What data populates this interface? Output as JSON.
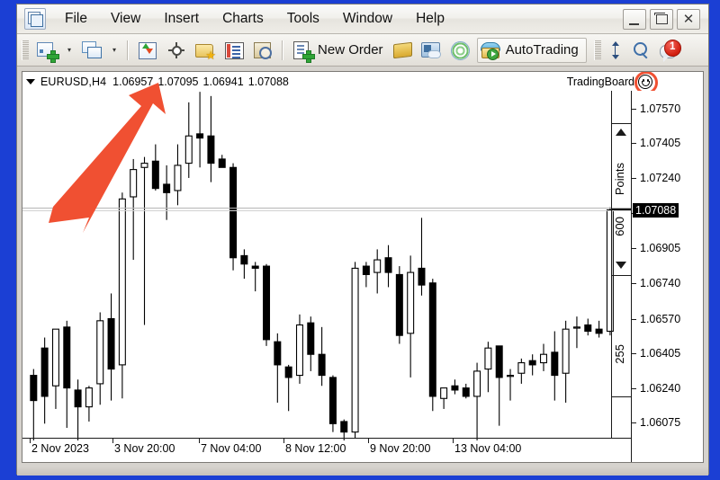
{
  "window": {
    "app_icon": "chart-app-icon",
    "menu": [
      "File",
      "View",
      "Insert",
      "Charts",
      "Tools",
      "Window",
      "Help"
    ],
    "controls": {
      "minimize": "minimize-button",
      "maximize": "maximize-button",
      "close": "close-button"
    }
  },
  "toolbar": {
    "new_chart": "new-chart-button",
    "new_chart_dropdown": "▾",
    "tile_windows": "tile-windows-button",
    "tile_dropdown": "▾",
    "market_watch": "market-watch-button",
    "crosshair": "crosshair-button",
    "favorites": "favorites-button",
    "data_window": "data-window-button",
    "navigator_search": "navigator-search-button",
    "new_order_label": "New Order",
    "notes": "notes-button",
    "news": "news-button",
    "signals": "signals-button",
    "autotrading_label": "AutoTrading",
    "resize_vertical": "resize-vertical-button",
    "zoom": "zoom-button",
    "alerts_badge": "1"
  },
  "chart": {
    "symbol": "EURUSD,H4",
    "ohlc": [
      "1.06957",
      "1.07095",
      "1.06941",
      "1.07088"
    ],
    "indicator_label": "TradingBoard",
    "smiley_icon": "smiley-face-icon",
    "current_price": "1.07088",
    "price_labels": [
      "1.07570",
      "1.07405",
      "1.07240",
      "1.06905",
      "1.06740",
      "1.06570",
      "1.06405",
      "1.06240",
      "1.06075"
    ],
    "time_labels": [
      "2 Nov 2023",
      "3 Nov 20:00",
      "7 Nov 04:00",
      "8 Nov 12:00",
      "9 Nov 20:00",
      "13 Nov 04:00"
    ],
    "gauge": {
      "up_arrow": "▲",
      "points_label": "Points",
      "spread_value": "600",
      "down_arrow": "▼",
      "lower_value": "255"
    },
    "annotation": {
      "arrow_color": "#F05032",
      "highlight_color": "#F05032",
      "target": "smiley-face-icon"
    }
  },
  "chart_data": {
    "type": "candlestick",
    "title": "EURUSD,H4",
    "xlabel": "",
    "ylabel": "",
    "ylim": [
      1.0599,
      1.07655
    ],
    "grid": false,
    "price_axis_ticks": [
      1.0757,
      1.07405,
      1.0724,
      1.07075,
      1.06905,
      1.0674,
      1.0657,
      1.06405,
      1.0624,
      1.06075
    ],
    "x_tick_labels": [
      "2 Nov 2023",
      "3 Nov 20:00",
      "7 Nov 04:00",
      "8 Nov 12:00",
      "9 Nov 20:00",
      "13 Nov 04:00"
    ],
    "current_price_line": 1.07088,
    "candles": [
      {
        "o": 1.063,
        "h": 1.0633,
        "l": 1.059,
        "c": 1.0618
      },
      {
        "o": 1.0643,
        "h": 1.0648,
        "l": 1.0607,
        "c": 1.062
      },
      {
        "o": 1.0625,
        "h": 1.0634,
        "l": 1.0614,
        "c": 1.0652
      },
      {
        "o": 1.0653,
        "h": 1.0656,
        "l": 1.0605,
        "c": 1.0624
      },
      {
        "o": 1.0623,
        "h": 1.0628,
        "l": 1.0596,
        "c": 1.0615
      },
      {
        "o": 1.0615,
        "h": 1.0625,
        "l": 1.0608,
        "c": 1.0624
      },
      {
        "o": 1.0626,
        "h": 1.066,
        "l": 1.0616,
        "c": 1.0656
      },
      {
        "o": 1.0657,
        "h": 1.0669,
        "l": 1.0618,
        "c": 1.0633
      },
      {
        "o": 1.0635,
        "h": 1.0717,
        "l": 1.0619,
        "c": 1.0714
      },
      {
        "o": 1.0715,
        "h": 1.0733,
        "l": 1.0685,
        "c": 1.0728
      },
      {
        "o": 1.0729,
        "h": 1.0734,
        "l": 1.0654,
        "c": 1.0731
      },
      {
        "o": 1.0732,
        "h": 1.074,
        "l": 1.0718,
        "c": 1.0719
      },
      {
        "o": 1.0721,
        "h": 1.073,
        "l": 1.0704,
        "c": 1.0717
      },
      {
        "o": 1.0718,
        "h": 1.074,
        "l": 1.0711,
        "c": 1.073
      },
      {
        "o": 1.0731,
        "h": 1.076,
        "l": 1.0724,
        "c": 1.0744
      },
      {
        "o": 1.0745,
        "h": 1.0765,
        "l": 1.0729,
        "c": 1.0743
      },
      {
        "o": 1.0744,
        "h": 1.0763,
        "l": 1.0722,
        "c": 1.0731
      },
      {
        "o": 1.0733,
        "h": 1.0735,
        "l": 1.073,
        "c": 1.0729
      },
      {
        "o": 1.0729,
        "h": 1.0731,
        "l": 1.068,
        "c": 1.0686
      },
      {
        "o": 1.0687,
        "h": 1.069,
        "l": 1.0676,
        "c": 1.0683
      },
      {
        "o": 1.0682,
        "h": 1.0684,
        "l": 1.067,
        "c": 1.0681
      },
      {
        "o": 1.0682,
        "h": 1.0683,
        "l": 1.0644,
        "c": 1.0647
      },
      {
        "o": 1.0646,
        "h": 1.065,
        "l": 1.0617,
        "c": 1.0635
      },
      {
        "o": 1.0634,
        "h": 1.0635,
        "l": 1.0613,
        "c": 1.0629
      },
      {
        "o": 1.063,
        "h": 1.0659,
        "l": 1.0626,
        "c": 1.0654
      },
      {
        "o": 1.0655,
        "h": 1.0658,
        "l": 1.0632,
        "c": 1.064
      },
      {
        "o": 1.064,
        "h": 1.0653,
        "l": 1.0625,
        "c": 1.063
      },
      {
        "o": 1.0629,
        "h": 1.063,
        "l": 1.0603,
        "c": 1.0607
      },
      {
        "o": 1.0608,
        "h": 1.0609,
        "l": 1.0598,
        "c": 1.0603
      },
      {
        "o": 1.0603,
        "h": 1.0684,
        "l": 1.06,
        "c": 1.0681
      },
      {
        "o": 1.0682,
        "h": 1.0684,
        "l": 1.0672,
        "c": 1.0678
      },
      {
        "o": 1.0679,
        "h": 1.069,
        "l": 1.0669,
        "c": 1.0685
      },
      {
        "o": 1.0686,
        "h": 1.0692,
        "l": 1.0672,
        "c": 1.0679
      },
      {
        "o": 1.0678,
        "h": 1.0682,
        "l": 1.0645,
        "c": 1.0649
      },
      {
        "o": 1.065,
        "h": 1.0687,
        "l": 1.0629,
        "c": 1.0679
      },
      {
        "o": 1.0681,
        "h": 1.0705,
        "l": 1.0668,
        "c": 1.0673
      },
      {
        "o": 1.0674,
        "h": 1.0676,
        "l": 1.0613,
        "c": 1.062
      },
      {
        "o": 1.0619,
        "h": 1.0624,
        "l": 1.0614,
        "c": 1.0624
      },
      {
        "o": 1.0625,
        "h": 1.0628,
        "l": 1.0621,
        "c": 1.0623
      },
      {
        "o": 1.0624,
        "h": 1.0626,
        "l": 1.0619,
        "c": 1.062
      },
      {
        "o": 1.062,
        "h": 1.0636,
        "l": 1.0594,
        "c": 1.0632
      },
      {
        "o": 1.0633,
        "h": 1.0646,
        "l": 1.0622,
        "c": 1.0643
      },
      {
        "o": 1.0644,
        "h": 1.0642,
        "l": 1.0606,
        "c": 1.0629
      },
      {
        "o": 1.063,
        "h": 1.0633,
        "l": 1.0618,
        "c": 1.063
      },
      {
        "o": 1.0631,
        "h": 1.0638,
        "l": 1.0626,
        "c": 1.0636
      },
      {
        "o": 1.0637,
        "h": 1.064,
        "l": 1.063,
        "c": 1.0635
      },
      {
        "o": 1.0636,
        "h": 1.0645,
        "l": 1.0632,
        "c": 1.064
      },
      {
        "o": 1.0641,
        "h": 1.0651,
        "l": 1.0618,
        "c": 1.063
      },
      {
        "o": 1.0631,
        "h": 1.0656,
        "l": 1.0617,
        "c": 1.0652
      },
      {
        "o": 1.0653,
        "h": 1.0658,
        "l": 1.0643,
        "c": 1.0653
      },
      {
        "o": 1.0654,
        "h": 1.0657,
        "l": 1.0649,
        "c": 1.0651
      },
      {
        "o": 1.0652,
        "h": 1.0656,
        "l": 1.0648,
        "c": 1.065
      },
      {
        "o": 1.0651,
        "h": 1.071,
        "l": 1.0649,
        "c": 1.07088
      }
    ]
  }
}
